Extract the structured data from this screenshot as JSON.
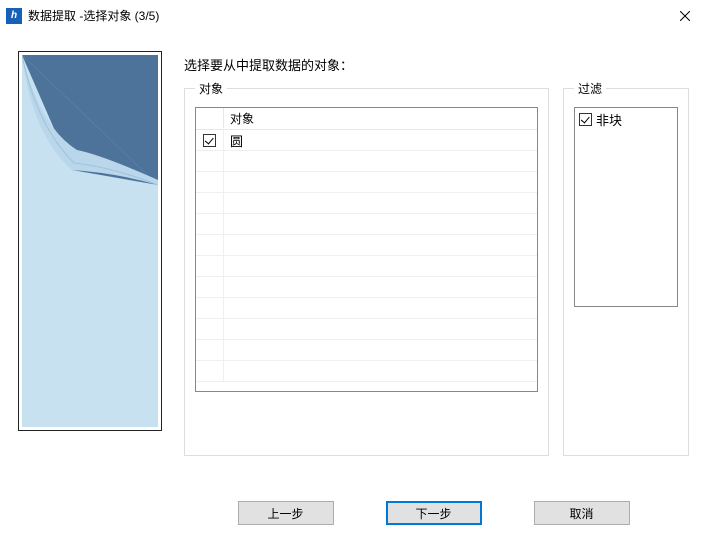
{
  "window": {
    "title": "数据提取 -选择对象 (3/5)"
  },
  "instruction": "选择要从中提取数据的对象：",
  "objects": {
    "legend": "对象",
    "header_col": "对象",
    "rows": [
      {
        "checked": true,
        "name": "圆"
      }
    ]
  },
  "filter": {
    "legend": "过滤",
    "rows": [
      {
        "checked": true,
        "name": "非块"
      }
    ]
  },
  "buttons": {
    "prev": "上一步",
    "next": "下一步",
    "cancel": "取消"
  }
}
